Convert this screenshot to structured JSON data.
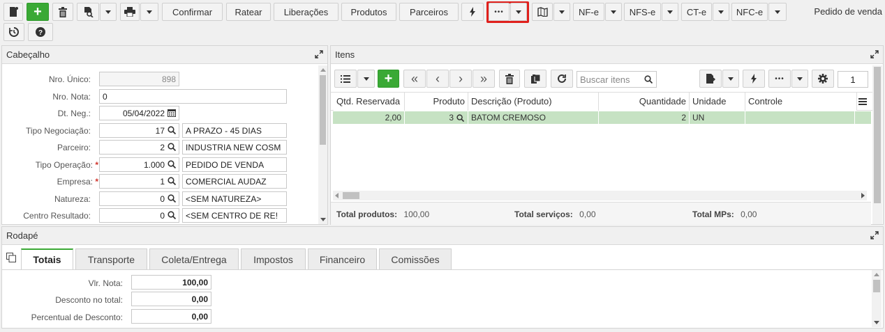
{
  "toolbar": {
    "confirmar": "Confirmar",
    "ratear": "Ratear",
    "liberacoes": "Liberações",
    "produtos": "Produtos",
    "parceiros": "Parceiros",
    "more": "•••",
    "nfe": "NF-e",
    "nfse": "NFS-e",
    "cte": "CT-e",
    "nfce": "NFC-e",
    "title": "Pedido de venda",
    "highlight_color": "#e0201c"
  },
  "cabecalho": {
    "title": "Cabeçalho",
    "fields": {
      "nro_unico": {
        "label": "Nro. Único:",
        "value": "898"
      },
      "nro_nota": {
        "label": "Nro. Nota:",
        "value": "0"
      },
      "dt_neg": {
        "label": "Dt. Neg.:",
        "value": "05/04/2022"
      },
      "tipo_negociacao": {
        "label": "Tipo Negociação:",
        "code": "17",
        "desc": "A PRAZO - 45 DIAS"
      },
      "parceiro": {
        "label": "Parceiro:",
        "code": "2",
        "desc": "INDUSTRIA NEW COSM"
      },
      "tipo_operacao": {
        "label": "Tipo Operação:",
        "code": "1.000",
        "desc": "PEDIDO DE VENDA"
      },
      "empresa": {
        "label": "Empresa:",
        "code": "1",
        "desc": "COMERCIAL AUDAZ"
      },
      "natureza": {
        "label": "Natureza:",
        "code": "0",
        "desc": "<SEM NATUREZA>"
      },
      "centro_resultado": {
        "label": "Centro Resultado:",
        "code": "0",
        "desc": "<SEM CENTRO DE RE!"
      }
    },
    "required_mark": "*"
  },
  "itens": {
    "title": "Itens",
    "search_placeholder": "Buscar itens",
    "page": "1",
    "columns": [
      "Qtd. Reservada",
      "Produto",
      "Descrição (Produto)",
      "Quantidade",
      "Unidade",
      "Controle"
    ],
    "rows": [
      {
        "qtd_reservada": "2,00",
        "produto": "3",
        "descricao": "BATOM CREMOSO",
        "quantidade": "2",
        "unidade": "UN",
        "controle": ""
      }
    ],
    "row_color": "#c6e2c3",
    "totals": {
      "produtos_label": "Total produtos:",
      "produtos_value": "100,00",
      "servicos_label": "Total serviços:",
      "servicos_value": "0,00",
      "mps_label": "Total MPs:",
      "mps_value": "0,00"
    }
  },
  "rodape": {
    "title": "Rodapé",
    "tabs": [
      "Totais",
      "Transporte",
      "Coleta/Entrega",
      "Impostos",
      "Financeiro",
      "Comissões"
    ],
    "active_tab": "Totais",
    "fields": [
      {
        "label": "Vlr. Nota:",
        "value": "100,00"
      },
      {
        "label": "Desconto no total:",
        "value": "0,00"
      },
      {
        "label": "Percentual de Desconto:",
        "value": "0,00"
      }
    ]
  },
  "colors": {
    "accent_green": "#3aa935",
    "required_red": "#d0342c"
  }
}
